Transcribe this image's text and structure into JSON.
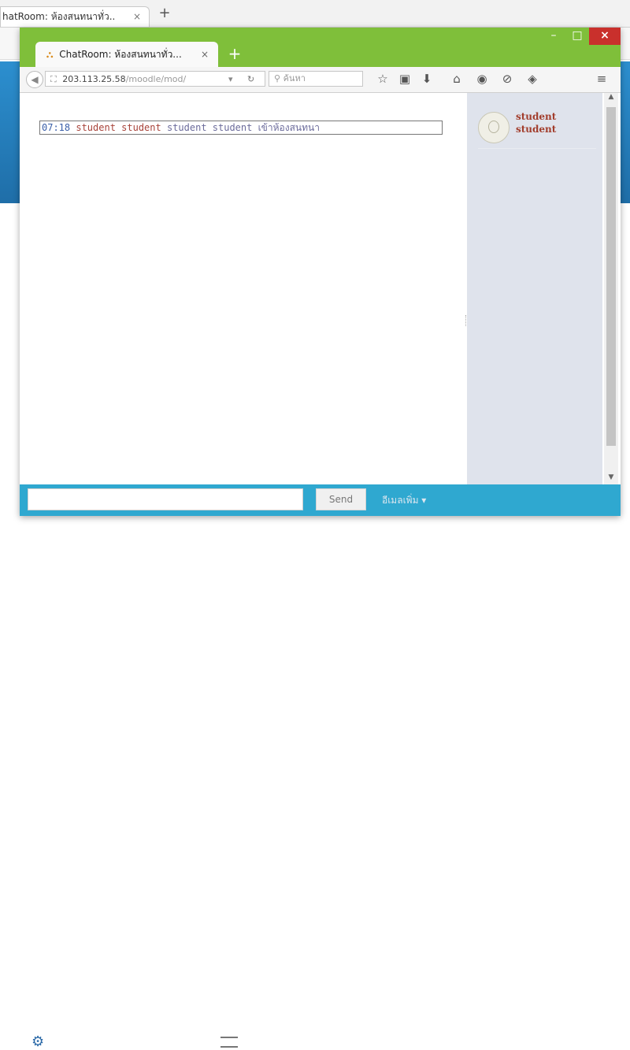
{
  "background_browser": {
    "tab_title": "hatRoom: ห้องสนทนาทั่ว..",
    "tab_close": "×",
    "new_tab": "+"
  },
  "popup": {
    "tab_title": "ChatRoom: ห้องสนทนาทั่ว...",
    "tab_close": "×",
    "new_tab": "+",
    "window_controls": {
      "minimize": "–",
      "maximize": "□",
      "close": "×"
    },
    "toolbar": {
      "url_host": "203.113.25.58",
      "url_path": "/moodle/mod/",
      "search_placeholder": "ค้นหา",
      "icons": [
        "star-icon",
        "clipboard-icon",
        "download-icon",
        "home-icon",
        "chat-icon",
        "sync-icon",
        "extension-icon",
        "menu-icon"
      ]
    },
    "chat": {
      "messages": [
        {
          "time": "07:18",
          "name": "student student",
          "text": "student student เข้าห้องสนทนา"
        }
      ]
    },
    "users": [
      {
        "first": "student",
        "last": "student"
      }
    ],
    "input": {
      "value": "",
      "send_label": "Send",
      "more_label": "อีเมลเพิ่ม ▾"
    }
  },
  "colors": {
    "window_frame": "#7fbf3a",
    "close_button": "#c9302c",
    "input_bar": "#2fa8d0",
    "user_pane": "#dfe3ec",
    "user_name": "#a23d2c"
  }
}
